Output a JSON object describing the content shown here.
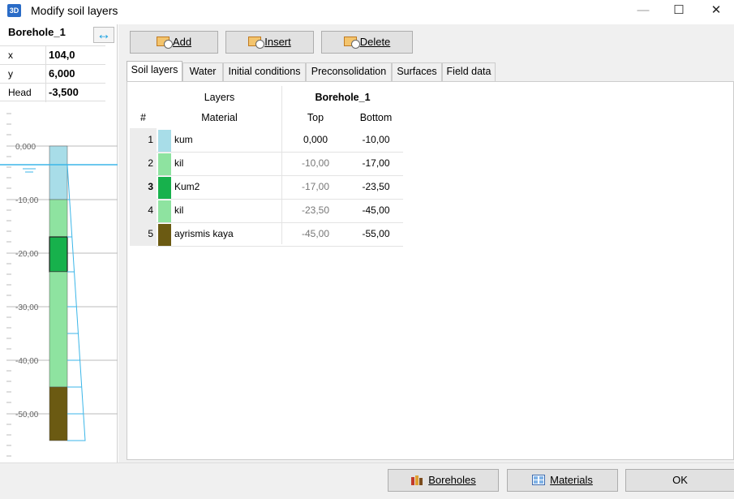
{
  "window": {
    "app_icon": "3D",
    "title": "Modify soil layers",
    "icons": [
      "minimize-icon",
      "maximize-icon",
      "close-icon"
    ]
  },
  "borehole": {
    "name": "Borehole_1",
    "fields": [
      {
        "key": "x",
        "value": "104,0"
      },
      {
        "key": "y",
        "value": "6,000"
      },
      {
        "key": "Head",
        "value": "-3,500"
      }
    ],
    "axis_labels": [
      "0,000",
      "-10,00",
      "-20,00",
      "-30,00",
      "-40,00",
      "-50,00"
    ]
  },
  "toolbar": {
    "add_label": "Add",
    "insert_label": "Insert",
    "delete_label": "Delete"
  },
  "tabs": [
    "Soil layers",
    "Water",
    "Initial conditions",
    "Preconsolidation",
    "Surfaces",
    "Field data"
  ],
  "table": {
    "group_layers": "Layers",
    "group_borehole": "Borehole_1",
    "col_num": "#",
    "col_material": "Material",
    "col_top": "Top",
    "col_bottom": "Bottom",
    "rows": [
      {
        "num": "1",
        "material": "kum",
        "top": "0,000",
        "bottom": "-10,00",
        "color": "#a8dde8"
      },
      {
        "num": "2",
        "material": "kil",
        "top": "-10,00",
        "bottom": "-17,00",
        "color": "#8ee3a0"
      },
      {
        "num": "3",
        "material": "Kum2",
        "top": "-17,00",
        "bottom": "-23,50",
        "color": "#17b14c"
      },
      {
        "num": "4",
        "material": "kil",
        "top": "-23,50",
        "bottom": "-45,00",
        "color": "#8ee3a0"
      },
      {
        "num": "5",
        "material": "ayrismis kaya",
        "top": "-45,00",
        "bottom": "-55,00",
        "color": "#6b5a12"
      }
    ]
  },
  "footer": {
    "boreholes_label": "Boreholes",
    "materials_label": "Materials",
    "ok_label": "OK"
  }
}
